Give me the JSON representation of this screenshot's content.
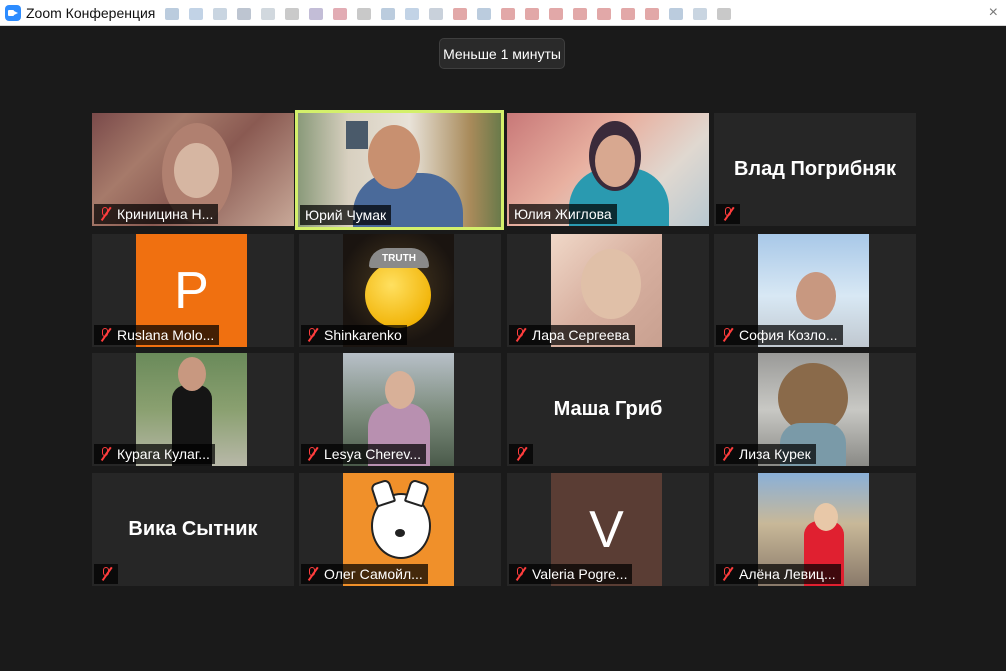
{
  "window": {
    "title": "Zoom Конференция"
  },
  "meeting": {
    "timer_label": "Меньше 1 минуты"
  },
  "participants": [
    {
      "name": "Криницина Н..."
    },
    {
      "name": "Юрий Чумак"
    },
    {
      "name": "Юлия Жиглова"
    },
    {
      "name": "Влад Погрибняк",
      "display_name": "Влад Погрибняк"
    },
    {
      "name": "Ruslana Molo...",
      "initial": "P"
    },
    {
      "name": "Shinkarenko",
      "badge_text": "TRUTH"
    },
    {
      "name": "Лара Сергеева"
    },
    {
      "name": "София Козло..."
    },
    {
      "name": "Курага Кулаг..."
    },
    {
      "name": "Lesya Cherev..."
    },
    {
      "name": "Маша Гриб",
      "display_name": "Маша Гриб"
    },
    {
      "name": "Лиза Курек"
    },
    {
      "name": "Вика Сытник",
      "display_name": "Вика Сытник"
    },
    {
      "name": "Олег Самойл..."
    },
    {
      "name": "Valeria Pogre...",
      "initial": "V"
    },
    {
      "name": "Алёна Левиц..."
    }
  ],
  "colors": {
    "active_speaker_border": "#d4f06b",
    "muted_icon": "#ff3d3d",
    "ruslana_avatar": "#f07010",
    "valeria_avatar": "#5a3d34"
  }
}
